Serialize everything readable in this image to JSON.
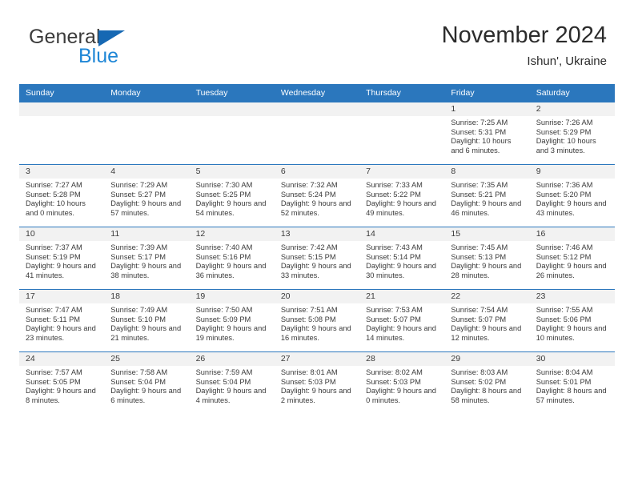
{
  "brand": {
    "name_top": "General",
    "name_bottom": "Blue",
    "accent_color": "#1e86d6",
    "triangle_color": "#1668b3"
  },
  "header": {
    "title": "November 2024",
    "subtitle": "Ishun', Ukraine"
  },
  "theme": {
    "header_row_bg": "#2b77bd",
    "daynum_band_bg": "#f2f2f2",
    "grid_line": "#2b77bd",
    "text": "#3a3a3a"
  },
  "weekday_headers": [
    "Sunday",
    "Monday",
    "Tuesday",
    "Wednesday",
    "Thursday",
    "Friday",
    "Saturday"
  ],
  "labels": {
    "sunrise_prefix": "Sunrise:",
    "sunset_prefix": "Sunset:",
    "daylight_prefix": "Daylight:"
  },
  "weeks": [
    [
      {
        "blank": true,
        "day": ""
      },
      {
        "blank": true,
        "day": ""
      },
      {
        "blank": true,
        "day": ""
      },
      {
        "blank": true,
        "day": ""
      },
      {
        "blank": true,
        "day": ""
      },
      {
        "blank": false,
        "day": "1",
        "sunrise": "Sunrise: 7:25 AM",
        "sunset": "Sunset: 5:31 PM",
        "daylight": "Daylight: 10 hours and 6 minutes."
      },
      {
        "blank": false,
        "day": "2",
        "sunrise": "Sunrise: 7:26 AM",
        "sunset": "Sunset: 5:29 PM",
        "daylight": "Daylight: 10 hours and 3 minutes."
      }
    ],
    [
      {
        "blank": false,
        "day": "3",
        "sunrise": "Sunrise: 7:27 AM",
        "sunset": "Sunset: 5:28 PM",
        "daylight": "Daylight: 10 hours and 0 minutes."
      },
      {
        "blank": false,
        "day": "4",
        "sunrise": "Sunrise: 7:29 AM",
        "sunset": "Sunset: 5:27 PM",
        "daylight": "Daylight: 9 hours and 57 minutes."
      },
      {
        "blank": false,
        "day": "5",
        "sunrise": "Sunrise: 7:30 AM",
        "sunset": "Sunset: 5:25 PM",
        "daylight": "Daylight: 9 hours and 54 minutes."
      },
      {
        "blank": false,
        "day": "6",
        "sunrise": "Sunrise: 7:32 AM",
        "sunset": "Sunset: 5:24 PM",
        "daylight": "Daylight: 9 hours and 52 minutes."
      },
      {
        "blank": false,
        "day": "7",
        "sunrise": "Sunrise: 7:33 AM",
        "sunset": "Sunset: 5:22 PM",
        "daylight": "Daylight: 9 hours and 49 minutes."
      },
      {
        "blank": false,
        "day": "8",
        "sunrise": "Sunrise: 7:35 AM",
        "sunset": "Sunset: 5:21 PM",
        "daylight": "Daylight: 9 hours and 46 minutes."
      },
      {
        "blank": false,
        "day": "9",
        "sunrise": "Sunrise: 7:36 AM",
        "sunset": "Sunset: 5:20 PM",
        "daylight": "Daylight: 9 hours and 43 minutes."
      }
    ],
    [
      {
        "blank": false,
        "day": "10",
        "sunrise": "Sunrise: 7:37 AM",
        "sunset": "Sunset: 5:19 PM",
        "daylight": "Daylight: 9 hours and 41 minutes."
      },
      {
        "blank": false,
        "day": "11",
        "sunrise": "Sunrise: 7:39 AM",
        "sunset": "Sunset: 5:17 PM",
        "daylight": "Daylight: 9 hours and 38 minutes."
      },
      {
        "blank": false,
        "day": "12",
        "sunrise": "Sunrise: 7:40 AM",
        "sunset": "Sunset: 5:16 PM",
        "daylight": "Daylight: 9 hours and 36 minutes."
      },
      {
        "blank": false,
        "day": "13",
        "sunrise": "Sunrise: 7:42 AM",
        "sunset": "Sunset: 5:15 PM",
        "daylight": "Daylight: 9 hours and 33 minutes."
      },
      {
        "blank": false,
        "day": "14",
        "sunrise": "Sunrise: 7:43 AM",
        "sunset": "Sunset: 5:14 PM",
        "daylight": "Daylight: 9 hours and 30 minutes."
      },
      {
        "blank": false,
        "day": "15",
        "sunrise": "Sunrise: 7:45 AM",
        "sunset": "Sunset: 5:13 PM",
        "daylight": "Daylight: 9 hours and 28 minutes."
      },
      {
        "blank": false,
        "day": "16",
        "sunrise": "Sunrise: 7:46 AM",
        "sunset": "Sunset: 5:12 PM",
        "daylight": "Daylight: 9 hours and 26 minutes."
      }
    ],
    [
      {
        "blank": false,
        "day": "17",
        "sunrise": "Sunrise: 7:47 AM",
        "sunset": "Sunset: 5:11 PM",
        "daylight": "Daylight: 9 hours and 23 minutes."
      },
      {
        "blank": false,
        "day": "18",
        "sunrise": "Sunrise: 7:49 AM",
        "sunset": "Sunset: 5:10 PM",
        "daylight": "Daylight: 9 hours and 21 minutes."
      },
      {
        "blank": false,
        "day": "19",
        "sunrise": "Sunrise: 7:50 AM",
        "sunset": "Sunset: 5:09 PM",
        "daylight": "Daylight: 9 hours and 19 minutes."
      },
      {
        "blank": false,
        "day": "20",
        "sunrise": "Sunrise: 7:51 AM",
        "sunset": "Sunset: 5:08 PM",
        "daylight": "Daylight: 9 hours and 16 minutes."
      },
      {
        "blank": false,
        "day": "21",
        "sunrise": "Sunrise: 7:53 AM",
        "sunset": "Sunset: 5:07 PM",
        "daylight": "Daylight: 9 hours and 14 minutes."
      },
      {
        "blank": false,
        "day": "22",
        "sunrise": "Sunrise: 7:54 AM",
        "sunset": "Sunset: 5:07 PM",
        "daylight": "Daylight: 9 hours and 12 minutes."
      },
      {
        "blank": false,
        "day": "23",
        "sunrise": "Sunrise: 7:55 AM",
        "sunset": "Sunset: 5:06 PM",
        "daylight": "Daylight: 9 hours and 10 minutes."
      }
    ],
    [
      {
        "blank": false,
        "day": "24",
        "sunrise": "Sunrise: 7:57 AM",
        "sunset": "Sunset: 5:05 PM",
        "daylight": "Daylight: 9 hours and 8 minutes."
      },
      {
        "blank": false,
        "day": "25",
        "sunrise": "Sunrise: 7:58 AM",
        "sunset": "Sunset: 5:04 PM",
        "daylight": "Daylight: 9 hours and 6 minutes."
      },
      {
        "blank": false,
        "day": "26",
        "sunrise": "Sunrise: 7:59 AM",
        "sunset": "Sunset: 5:04 PM",
        "daylight": "Daylight: 9 hours and 4 minutes."
      },
      {
        "blank": false,
        "day": "27",
        "sunrise": "Sunrise: 8:01 AM",
        "sunset": "Sunset: 5:03 PM",
        "daylight": "Daylight: 9 hours and 2 minutes."
      },
      {
        "blank": false,
        "day": "28",
        "sunrise": "Sunrise: 8:02 AM",
        "sunset": "Sunset: 5:03 PM",
        "daylight": "Daylight: 9 hours and 0 minutes."
      },
      {
        "blank": false,
        "day": "29",
        "sunrise": "Sunrise: 8:03 AM",
        "sunset": "Sunset: 5:02 PM",
        "daylight": "Daylight: 8 hours and 58 minutes."
      },
      {
        "blank": false,
        "day": "30",
        "sunrise": "Sunrise: 8:04 AM",
        "sunset": "Sunset: 5:01 PM",
        "daylight": "Daylight: 8 hours and 57 minutes."
      }
    ]
  ]
}
